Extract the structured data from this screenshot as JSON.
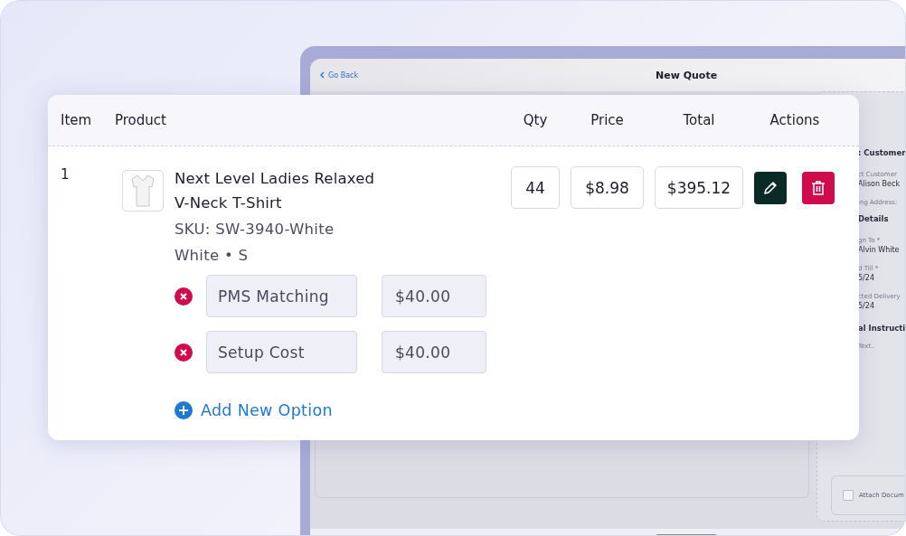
{
  "background_window": {
    "back_link": "Go Back",
    "title": "New Quote",
    "side_panel": [
      {
        "kind": "heading",
        "text": ": Customer"
      },
      {
        "kind": "label",
        "text": "ct Customer"
      },
      {
        "kind": "value",
        "text": "Alison Beck"
      },
      {
        "kind": "label",
        "text": "ing Address:"
      },
      {
        "kind": "heading",
        "text": "Details"
      },
      {
        "kind": "label",
        "text": "gn To *"
      },
      {
        "kind": "value",
        "text": "Alvin White"
      },
      {
        "kind": "label",
        "text": "d Till *"
      },
      {
        "kind": "value",
        "text": "5/24"
      },
      {
        "kind": "label",
        "text": "cted Delivery"
      },
      {
        "kind": "value",
        "text": "5/24"
      },
      {
        "kind": "heading",
        "text": "al Instructi"
      },
      {
        "kind": "placeholder",
        "text": "Text.."
      }
    ],
    "attach": {
      "label": "Attach Docum",
      "checked": false
    }
  },
  "quote_table": {
    "columns": [
      "Item",
      "Product",
      "Qty",
      "Price",
      "Total",
      "Actions"
    ],
    "rows": [
      {
        "item": "1",
        "product": "Next Level Ladies Relaxed V-Neck T-Shirt",
        "sku": "SKU: SW-3940-White",
        "variant": "White • S",
        "qty": "44",
        "price": "$8.98",
        "total": "$395.12",
        "options": [
          {
            "name": "PMS Matching",
            "price": "$40.00"
          },
          {
            "name": "Setup Cost",
            "price": "$40.00"
          }
        ],
        "add_option": "Add New Option"
      }
    ]
  }
}
